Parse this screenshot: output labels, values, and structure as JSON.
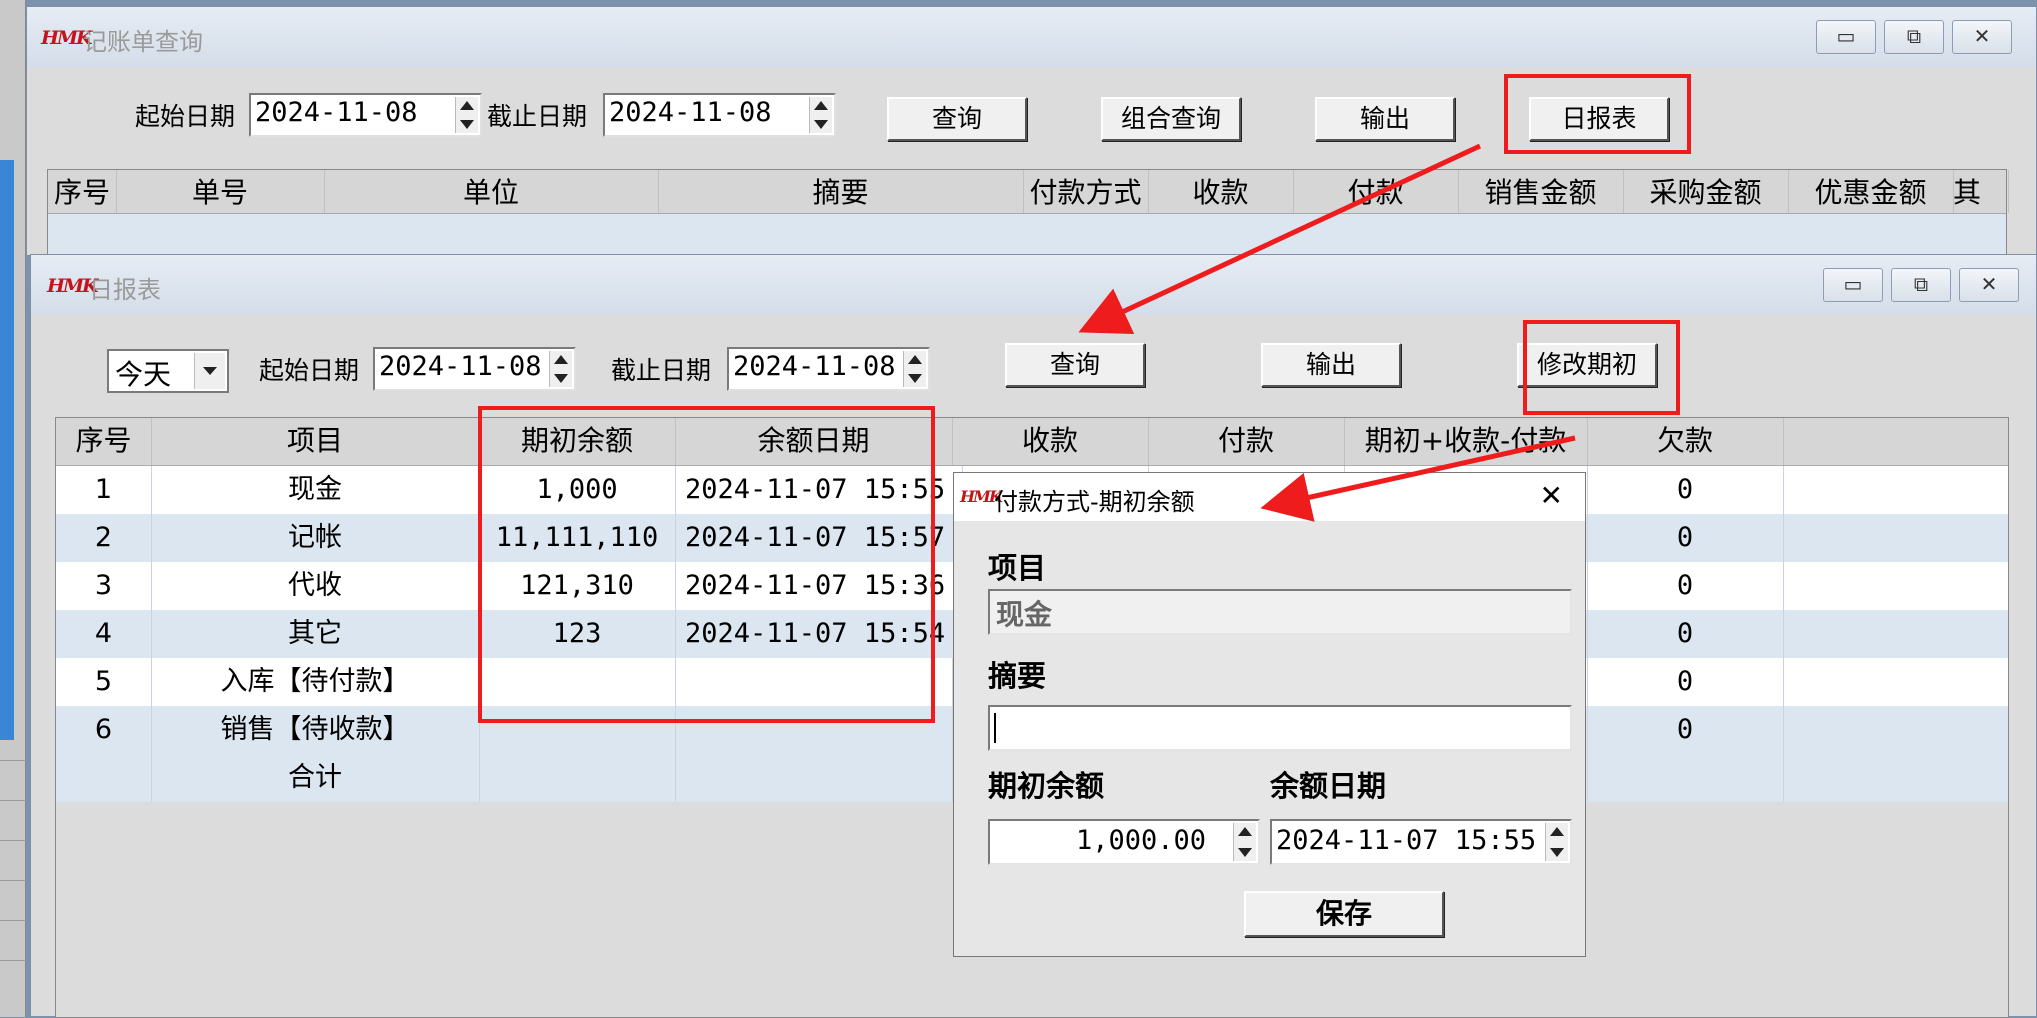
{
  "top_window": {
    "logo": "HMK",
    "title": "记账单查询",
    "start_label": "起始日期",
    "start_value": "2024-11-08",
    "end_label": "截止日期",
    "end_value": "2024-11-08",
    "buttons": {
      "query": "查询",
      "combo_query": "组合查询",
      "export": "输出",
      "daily_report": "日报表"
    },
    "columns": [
      "序号",
      "单号",
      "单位",
      "摘要",
      "付款方式",
      "收款",
      "付款",
      "销售金额",
      "采购金额",
      "优惠金额",
      "其"
    ],
    "window_controls": {
      "minimize": "▭",
      "restore": "⧉",
      "close": "✕"
    }
  },
  "report_window": {
    "logo": "HMK",
    "title": "日报表",
    "period_select": "今天",
    "start_label": "起始日期",
    "start_value": "2024-11-08",
    "end_label": "截止日期",
    "end_value": "2024-11-08",
    "buttons": {
      "query": "查询",
      "export": "输出",
      "edit_opening": "修改期初"
    },
    "columns": [
      "序号",
      "项目",
      "期初余额",
      "余额日期",
      "收款",
      "付款",
      "期初+收款-付款",
      "欠款"
    ],
    "rows": [
      {
        "no": "1",
        "item": "现金",
        "opening": "1,000",
        "date": "2024-11-07 15:55",
        "debt": "0"
      },
      {
        "no": "2",
        "item": "记帐",
        "opening": "11,111,110",
        "date": "2024-11-07 15:57",
        "debt": "0"
      },
      {
        "no": "3",
        "item": "代收",
        "opening": "121,310",
        "date": "2024-11-07 15:36",
        "debt": "0"
      },
      {
        "no": "4",
        "item": "其它",
        "opening": "123",
        "date": "2024-11-07 15:54",
        "debt": "0"
      },
      {
        "no": "5",
        "item": "入库【待付款】",
        "opening": "",
        "date": "",
        "debt": "0"
      },
      {
        "no": "6",
        "item": "销售【待收款】",
        "opening": "",
        "date": "",
        "debt": "0"
      }
    ],
    "total_label": "合计"
  },
  "dialog": {
    "logo": "HMK",
    "title": "付款方式-期初余额",
    "close": "✕",
    "item_label": "项目",
    "item_value": "现金",
    "summary_label": "摘要",
    "summary_value": "",
    "opening_label": "期初余额",
    "opening_value": "1,000.00",
    "date_label": "余额日期",
    "date_value": "2024-11-07 15:55",
    "save": "保存"
  },
  "colors": {
    "annotation_red": "#ee1c1c",
    "row_alt": "#dce6f1",
    "logo_red": "#c4141b"
  }
}
